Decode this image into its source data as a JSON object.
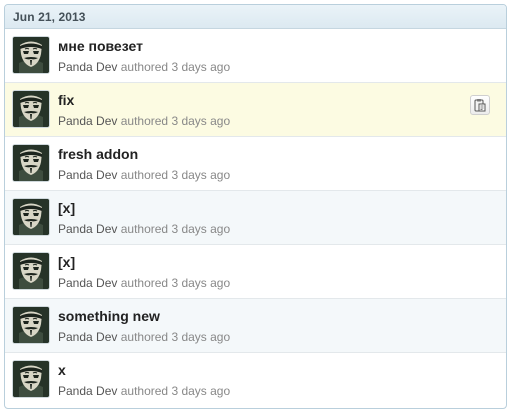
{
  "group": {
    "date": "Jun 21, 2013"
  },
  "commits": [
    {
      "message": "мне повезет",
      "author": "Panda Dev",
      "authored_label": "authored",
      "time": "3 days ago"
    },
    {
      "message": "fix",
      "author": "Panda Dev",
      "authored_label": "authored",
      "time": "3 days ago"
    },
    {
      "message": "fresh addon",
      "author": "Panda Dev",
      "authored_label": "authored",
      "time": "3 days ago"
    },
    {
      "message": "[x]",
      "author": "Panda Dev",
      "authored_label": "authored",
      "time": "3 days ago"
    },
    {
      "message": "[x]",
      "author": "Panda Dev",
      "authored_label": "authored",
      "time": "3 days ago"
    },
    {
      "message": "something new",
      "author": "Panda Dev",
      "authored_label": "authored",
      "time": "3 days ago"
    },
    {
      "message": "x",
      "author": "Panda Dev",
      "authored_label": "authored",
      "time": "3 days ago"
    }
  ],
  "icons": {
    "avatar": "masked-avatar-icon",
    "copy": "clipboard-copy-icon"
  },
  "colors": {
    "header_bg": "#dce9f1",
    "highlight_row": "#fcfbe2",
    "alt_row": "#f4f8fa",
    "border": "#b9cfdc"
  }
}
